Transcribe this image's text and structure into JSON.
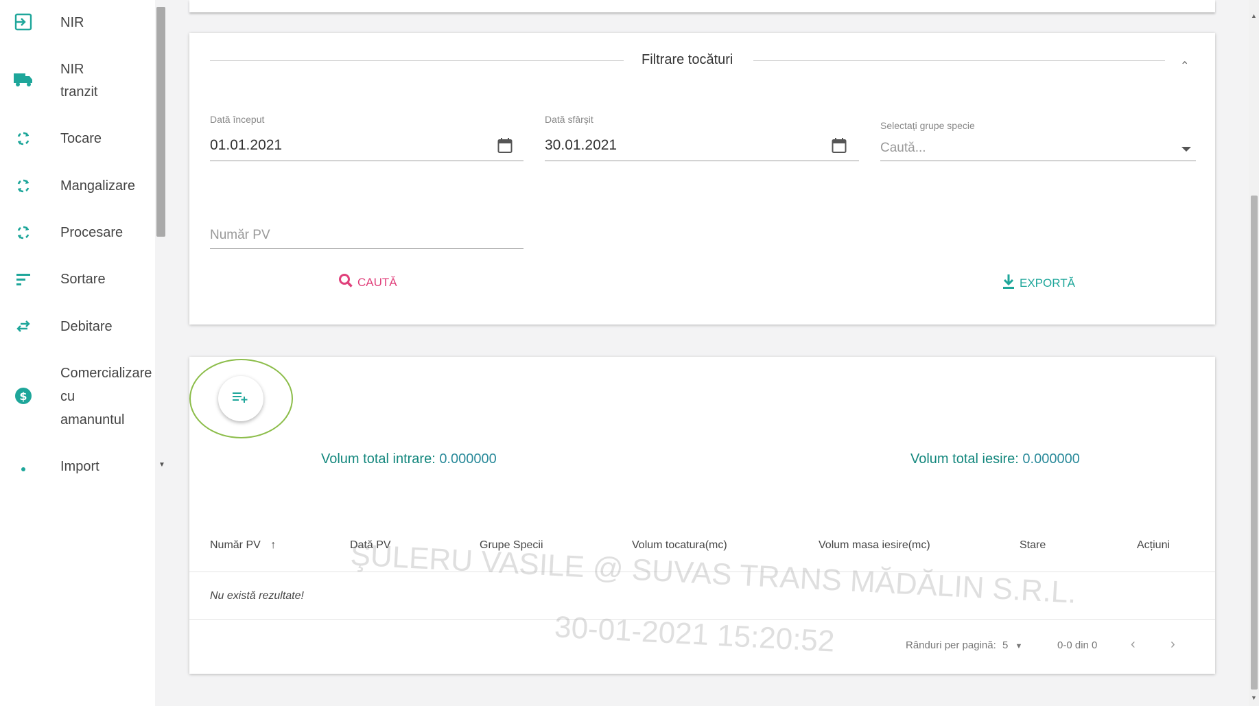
{
  "sidebar": {
    "items": [
      {
        "label": "NIR",
        "icon": "login-icon"
      },
      {
        "label": "NIR tranzit",
        "line1": "NIR",
        "line2": "tranzit",
        "icon": "truck-icon"
      },
      {
        "label": "Tocare",
        "icon": "sync-icon"
      },
      {
        "label": "Mangalizare",
        "icon": "sync-icon"
      },
      {
        "label": "Procesare",
        "icon": "sync-icon"
      },
      {
        "label": "Sortare",
        "icon": "sort-icon"
      },
      {
        "label": "Debitare",
        "icon": "swap-icon"
      },
      {
        "label": "Comercializare cu amanuntul",
        "line1": "Comercializare",
        "line2": "cu",
        "line3": "amanuntul",
        "icon": "money-icon"
      },
      {
        "label": "Import",
        "icon": "dot-icon"
      }
    ]
  },
  "filter": {
    "title": "Filtrare tocături",
    "start_label": "Dată început",
    "start_value": "01.01.2021",
    "end_label": "Dată sfârșit",
    "end_value": "30.01.2021",
    "species_label": "Selectați grupe specie",
    "species_placeholder": "Caută...",
    "pv_placeholder": "Număr PV",
    "search_label": "CAUTĂ",
    "export_label": "EXPORTĂ"
  },
  "totals": {
    "in_label": "Volum total intrare:",
    "in_value": "0.000000",
    "out_label": "Volum total iesire:",
    "out_value": "0.000000"
  },
  "table": {
    "columns": [
      "Număr PV",
      "Dată PV",
      "Grupe Specii",
      "Volum tocatura(mc)",
      "Volum masa iesire(mc)",
      "Stare",
      "Acțiuni"
    ],
    "empty_message": "Nu există rezultate!"
  },
  "pagination": {
    "rows_label": "Rânduri per pagină:",
    "rows_value": "5",
    "range": "0-0 din 0"
  },
  "watermark": {
    "line1": "ŞULERU VASILE @ SUVAS TRANS MĂDĂLIN S.R.L.",
    "line2": "30-01-2021 15:20:52"
  },
  "colors": {
    "accent_pink": "#e0407b",
    "accent_teal": "#1ea69a",
    "highlight_ring": "#8cbd4a"
  }
}
